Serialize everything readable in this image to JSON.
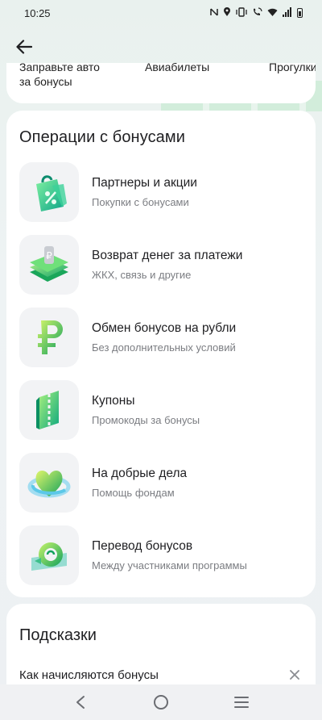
{
  "status_bar": {
    "time": "10:25",
    "icons": [
      "nfc-icon",
      "location-icon",
      "vibrate-icon",
      "wifi-call-icon",
      "wifi-icon",
      "signal-icon",
      "battery-icon"
    ]
  },
  "header": {
    "back_icon": "arrow-left-icon"
  },
  "top_card": {
    "items": [
      {
        "label_line1": "Заправьте авто",
        "label_line2": "за бонусы"
      },
      {
        "label_line1": "Авиабилеты"
      },
      {
        "label_line1": "Прогулки"
      }
    ]
  },
  "operations": {
    "title": "Операции с бонусами",
    "items": [
      {
        "title": "Партнеры и акции",
        "subtitle": "Покупки с бонусами",
        "icon": "shopping-bag-percent-icon"
      },
      {
        "title": "Возврат денег за платежи",
        "subtitle": "ЖКХ, связь и другие",
        "icon": "ruble-stack-icon"
      },
      {
        "title": "Обмен бонусов на рубли",
        "subtitle": "Без дополнительных условий",
        "icon": "ruble-icon"
      },
      {
        "title": "Купоны",
        "subtitle": "Промокоды за бонусы",
        "icon": "coupon-icon"
      },
      {
        "title": "На добрые дела",
        "subtitle": "Помощь фондам",
        "icon": "heart-icon"
      },
      {
        "title": "Перевод бонусов",
        "subtitle": "Между участниками программы",
        "icon": "transfer-icon"
      }
    ]
  },
  "hints": {
    "title": "Подсказки",
    "items": [
      {
        "text": "Как начисляются бонусы",
        "close_icon": "close-icon"
      }
    ]
  },
  "nav_bar": {
    "buttons": [
      "back-nav-icon",
      "home-nav-icon",
      "recents-nav-icon"
    ]
  },
  "colors": {
    "accent_green": "#21a038",
    "card_bg": "#ffffff",
    "tile_bg": "#f2f3f5",
    "secondary_text": "#7b7d82"
  }
}
